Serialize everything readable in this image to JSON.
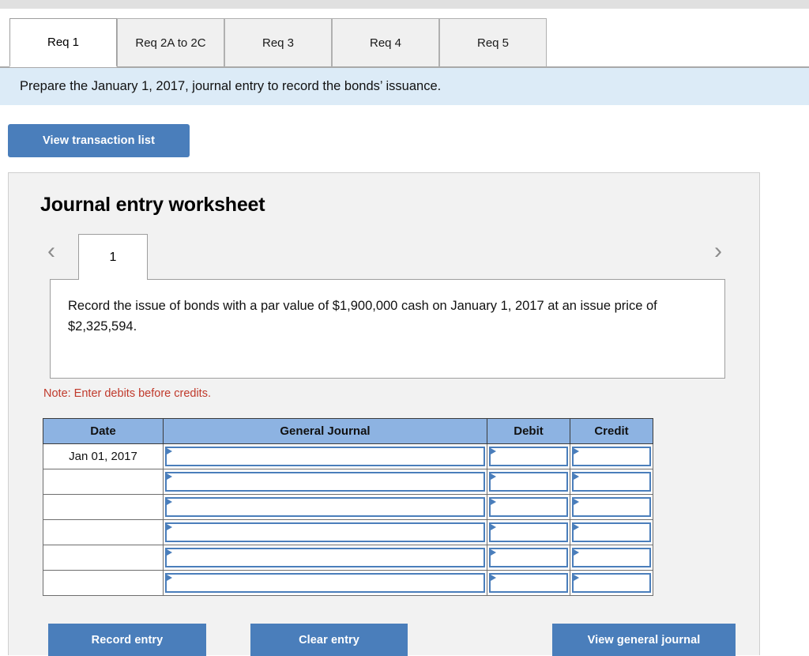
{
  "tabs": [
    {
      "label": "Req 1",
      "active": true
    },
    {
      "label": "Req 2A to 2C",
      "active": false
    },
    {
      "label": "Req 3",
      "active": false
    },
    {
      "label": "Req 4",
      "active": false
    },
    {
      "label": "Req 5",
      "active": false
    }
  ],
  "instruction": "Prepare the January 1, 2017, journal entry to record the bonds’ issuance.",
  "transaction_button": "View transaction list",
  "worksheet": {
    "title": "Journal entry worksheet",
    "prev_icon": "chevron-left-icon",
    "next_icon": "chevron-right-icon",
    "page_tab": "1",
    "description": "Record the issue of bonds with a par value of $1,900,000 cash on January 1, 2017 at an issue price of $2,325,594.",
    "note": "Note: Enter debits before credits."
  },
  "table": {
    "headers": [
      "Date",
      "General Journal",
      "Debit",
      "Credit"
    ],
    "rows": [
      {
        "date": "Jan 01, 2017",
        "journal": "",
        "debit": "",
        "credit": ""
      },
      {
        "date": "",
        "journal": "",
        "debit": "",
        "credit": ""
      },
      {
        "date": "",
        "journal": "",
        "debit": "",
        "credit": ""
      },
      {
        "date": "",
        "journal": "",
        "debit": "",
        "credit": ""
      },
      {
        "date": "",
        "journal": "",
        "debit": "",
        "credit": ""
      },
      {
        "date": "",
        "journal": "",
        "debit": "",
        "credit": ""
      }
    ]
  },
  "footer_buttons": {
    "record": "Record entry",
    "clear": "Clear entry",
    "view_journal": "View general journal"
  },
  "colors": {
    "button_blue": "#4a7ebb",
    "header_blue": "#8db3e2",
    "instruction_blue": "#dcebf7",
    "note_red": "#c0392b",
    "panel_gray": "#f2f2f2"
  }
}
